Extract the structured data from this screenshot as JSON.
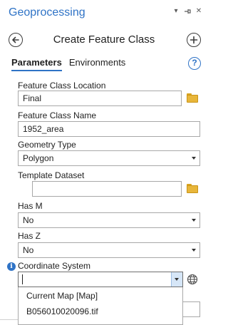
{
  "pane": {
    "title": "Geoprocessing",
    "controls": [
      "options-menu",
      "auto-hide",
      "close"
    ]
  },
  "tool": {
    "title": "Create Feature Class"
  },
  "tabs": [
    {
      "label": "Parameters",
      "active": true
    },
    {
      "label": "Environments",
      "active": false
    }
  ],
  "help_glyph": "?",
  "fields": {
    "location": {
      "label": "Feature Class Location",
      "value": "Final"
    },
    "name": {
      "label": "Feature Class Name",
      "value": "1952_area"
    },
    "geometry": {
      "label": "Geometry Type",
      "value": "Polygon"
    },
    "template": {
      "label": "Template Dataset",
      "value": ""
    },
    "has_m": {
      "label": "Has M",
      "value": "No"
    },
    "has_z": {
      "label": "Has Z",
      "value": "No"
    },
    "coordinate_system": {
      "label": "Coordinate System",
      "value": ""
    }
  },
  "coordinate_dropdown": {
    "options": [
      "Current Map [Map]",
      "B056010020096.tif"
    ]
  },
  "colors": {
    "accent": "#2f73c6",
    "folder": "#e8b63a",
    "combo_button": "#d6e6f7"
  },
  "icons": [
    "chevron-down-icon",
    "pin-icon",
    "close-icon",
    "back-arrow-icon",
    "add-icon",
    "help-icon",
    "folder-icon",
    "info-icon",
    "globe-icon"
  ]
}
